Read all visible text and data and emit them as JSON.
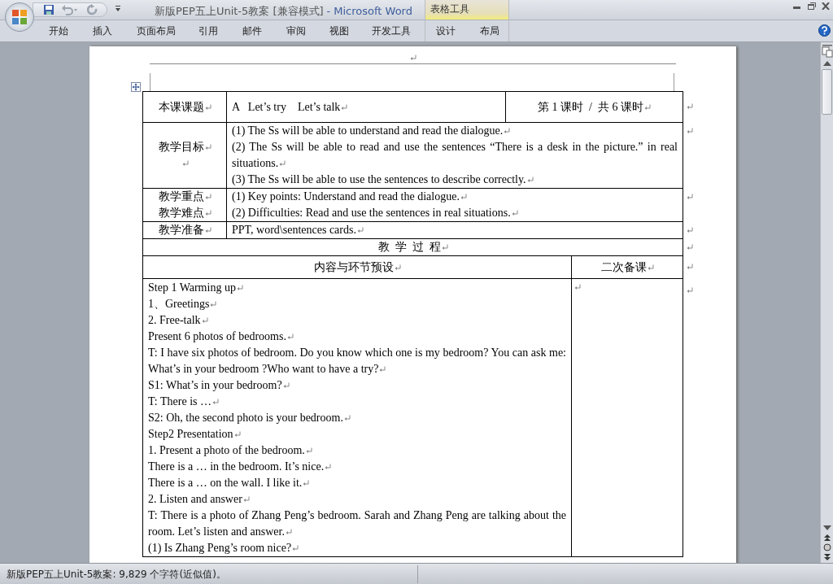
{
  "window": {
    "title": "新版PEP五上Unit-5教案 [兼容模式]",
    "app_name": "- Microsoft Word",
    "contextual_group": "表格工具"
  },
  "ribbon_tabs": [
    {
      "label": "开始",
      "selected": false
    },
    {
      "label": "插入",
      "selected": false
    },
    {
      "label": "页面布局",
      "selected": false
    },
    {
      "label": "引用",
      "selected": false
    },
    {
      "label": "邮件",
      "selected": false
    },
    {
      "label": "审阅",
      "selected": false
    },
    {
      "label": "视图",
      "selected": false
    },
    {
      "label": "开发工具",
      "selected": false
    }
  ],
  "contextual_tabs": [
    {
      "label": "设计",
      "selected": false
    },
    {
      "label": "布局",
      "selected": false
    }
  ],
  "document": {
    "formatting_marks": true,
    "lesson_table": {
      "topic": {
        "label": "本课课题",
        "title": "A   Let’s try    Let’s talk",
        "period": "第 1 课时  /  共 6 课时"
      },
      "info_rows": [
        {
          "labels": [
            {
              "kind": "text",
              "text": "教学目标"
            },
            {
              "kind": "empty"
            }
          ],
          "lines": [
            "(1) The Ss will be able to understand and read the dialogue.",
            "(2) The Ss will be able to read and use the sentences “There is a desk in the picture.” in real situations.",
            "(3) The Ss will be able to use the sentences to describe correctly."
          ]
        },
        {
          "labels": [
            {
              "kind": "text",
              "text": "教学重点"
            },
            {
              "kind": "text",
              "text": "教学难点"
            }
          ],
          "lines": [
            "(1) Key points: Understand and read the dialogue.",
            "(2) Difficulties: Read and use the sentences in real situations."
          ]
        },
        {
          "labels": [
            {
              "kind": "text",
              "text": "教学准备"
            }
          ],
          "lines": [
            "PPT, word\\sentences cards."
          ]
        }
      ],
      "process_heading": "教  学  过  程",
      "columns": [
        "内容与环节预设",
        "二次备课"
      ],
      "process_lines": [
        "Step 1 Warming up",
        "1、Greetings",
        "2. Free-talk",
        "Present 6 photos of bedrooms.",
        "T: I have six photos of bedroom. Do you know which one is my bedroom? You can ask me: What’s in your bedroom ?Who want to have a try?",
        "S1: What’s in your bedroom?",
        "T: There is …",
        "S2: Oh, the second photo is your bedroom.",
        "Step2 Presentation",
        "1. Present a photo of the bedroom.",
        "There is a … in the bedroom. It’s nice.",
        "There is a … on the wall. I like it.",
        "2. Listen and answer",
        "T: There is a photo of Zhang Peng’s bedroom. Sarah and Zhang Peng are talking about the room. Let’s listen and answer.",
        "(1) Is Zhang Peng’s room nice?"
      ]
    }
  },
  "status_bar": {
    "text": "新版PEP五上Unit-5教案: 9,829 个字符(近似值)。"
  }
}
